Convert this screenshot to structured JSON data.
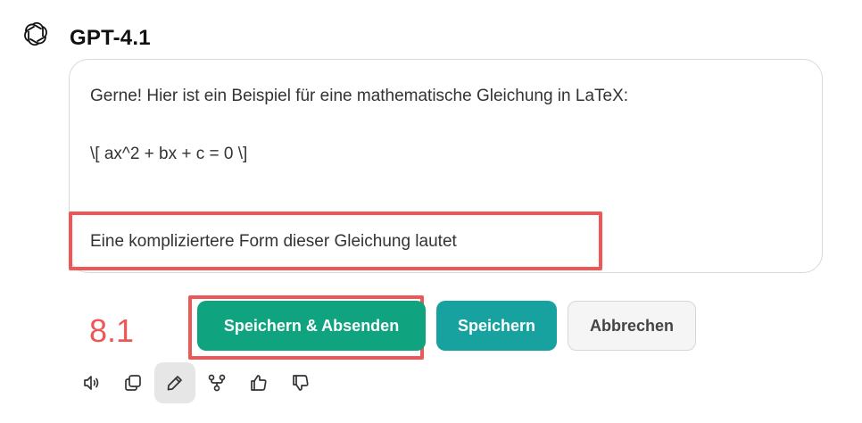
{
  "header": {
    "model_name": "GPT-4.1",
    "logo_icon": "openai-logo-icon"
  },
  "message": {
    "lines": [
      "Gerne! Hier ist ein Beispiel für eine mathematische Gleichung in LaTeX:",
      "\\[ ax^2 + bx + c = 0 \\]",
      "Eine kompliziertere Form dieser Gleichung lautet"
    ]
  },
  "annotation": {
    "step_label": "8.1",
    "color": "#ef5757"
  },
  "actions": {
    "send_label": "Speichern & Absenden",
    "save_label": "Speichern",
    "cancel_label": "Abbrechen",
    "send_color": "#10a37f",
    "save_color": "#17a2a0"
  },
  "toolbar": {
    "icons": [
      "speaker-icon",
      "copy-icon",
      "pencil-icon",
      "branch-icon",
      "thumbs-up-icon",
      "thumbs-down-icon"
    ],
    "active": "pencil-icon"
  }
}
